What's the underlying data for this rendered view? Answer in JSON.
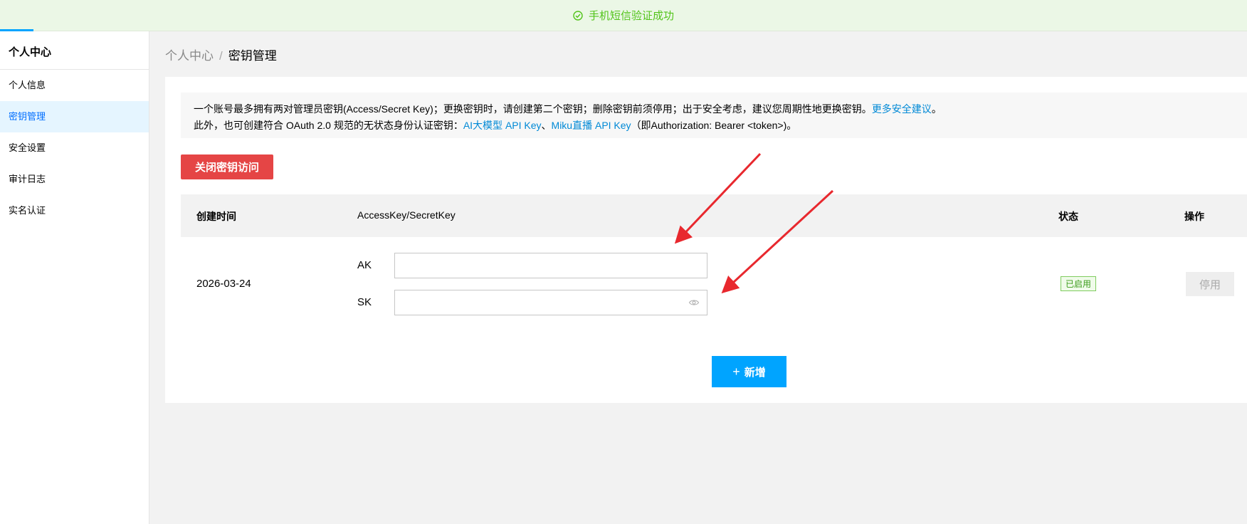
{
  "toast": {
    "message": "手机短信验证成功"
  },
  "sidebar": {
    "title": "个人中心",
    "items": [
      {
        "label": "个人信息"
      },
      {
        "label": "密钥管理"
      },
      {
        "label": "安全设置"
      },
      {
        "label": "审计日志"
      },
      {
        "label": "实名认证"
      }
    ]
  },
  "breadcrumb": {
    "parent": "个人中心",
    "separator": "/",
    "current": "密钥管理"
  },
  "notice": {
    "line1_text": "一个账号最多拥有两对管理员密钥(Access/Secret Key)；更换密钥时，请创建第二个密钥；删除密钥前须停用；出于安全考虑，建议您周期性地更换密钥。",
    "line1_link": "更多安全建议",
    "line1_end": "。",
    "line2_text": "此外，也可创建符合 OAuth 2.0 规范的无状态身份认证密钥：",
    "line2_link1": "AI大模型 API Key",
    "line2_sep": "、",
    "line2_link2": "Miku直播 API Key",
    "line2_end": "（即Authorization: Bearer <token>)。"
  },
  "actions": {
    "close_access": "关闭密钥访问",
    "add": "新增"
  },
  "table": {
    "headers": {
      "time": "创建时间",
      "key": "AccessKey/SecretKey",
      "status": "状态",
      "operation": "操作"
    },
    "rows": [
      {
        "created": "2026-03-24",
        "ak_label": "AK",
        "sk_label": "SK",
        "ak_value": "",
        "sk_value": "",
        "status": "已启用",
        "operation": "停用"
      }
    ]
  },
  "colors": {
    "accent": "#00a4ff",
    "danger": "#e54545",
    "success": "#52c41a",
    "annotation_arrow": "#e8282e"
  },
  "icons": {
    "toast": "check-circle-icon",
    "add": "plus-icon",
    "reveal": "eye-icon"
  }
}
